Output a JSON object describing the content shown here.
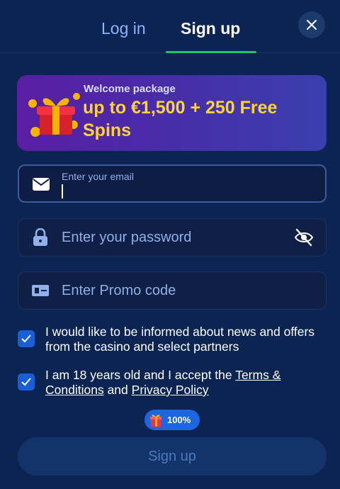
{
  "tabs": [
    {
      "label": "Log in",
      "active": false
    },
    {
      "label": "Sign up",
      "active": true
    }
  ],
  "banner": {
    "subtitle": "Welcome package",
    "offer": "up to €1,500 + 250 Free Spins",
    "icon": "gift-icon"
  },
  "fields": {
    "email": {
      "floating_label": "Enter your email",
      "value": "",
      "icon": "envelope-icon"
    },
    "password": {
      "placeholder": "Enter your password",
      "icon": "lock-icon",
      "toggle_icon": "eye-off-icon"
    },
    "promo": {
      "placeholder": "Enter Promo code",
      "icon": "ticket-icon"
    }
  },
  "consents": {
    "news": {
      "text": "I would like to be informed about news and offers from the casino and select partners",
      "checked": true
    },
    "age": {
      "prefix": "I am 18 years old and I accept the ",
      "terms": "Terms & Conditions",
      "and": " and ",
      "privacy": "Privacy Policy",
      "checked": true
    }
  },
  "bonus_badge": {
    "percent": "100%",
    "icon": "gift-icon"
  },
  "submit": {
    "label": "Sign up"
  },
  "colors": {
    "background": "#0b2451",
    "accent": "#22c36a",
    "banner_text": "#ffd431",
    "checkbox": "#1a5ed6"
  }
}
